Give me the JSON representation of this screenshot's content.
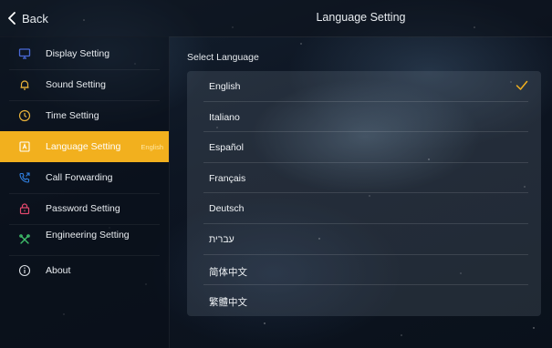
{
  "header": {
    "back_label": "Back",
    "title": "Language Setting"
  },
  "sidebar": {
    "items": [
      {
        "label": "Display Setting",
        "icon": "monitor-icon"
      },
      {
        "label": "Sound Setting",
        "icon": "bell-icon"
      },
      {
        "label": "Time Setting",
        "icon": "clock-icon"
      },
      {
        "label": "Language Setting",
        "icon": "language-icon",
        "active": true,
        "value": "English"
      },
      {
        "label": "Call Forwarding",
        "icon": "phone-forward-icon"
      },
      {
        "label": "Password Setting",
        "icon": "lock-icon"
      },
      {
        "label": "Engineering Setting",
        "icon": "tools-icon"
      },
      {
        "label": "About",
        "icon": "info-icon"
      }
    ]
  },
  "main": {
    "section_label": "Select Language",
    "languages": [
      "English",
      "Italiano",
      "Español",
      "Français",
      "Deutsch",
      "עברית",
      "简体中文",
      "繁體中文"
    ],
    "selected": "English"
  },
  "colors": {
    "accent": "#f2b01e",
    "monitor": "#4a6ad8",
    "bell": "#e8b23a",
    "clock": "#e8b23a",
    "phone": "#2f7fe0",
    "lock": "#e2486d",
    "tools": "#3fbf6a",
    "info": "#d9dde2"
  }
}
